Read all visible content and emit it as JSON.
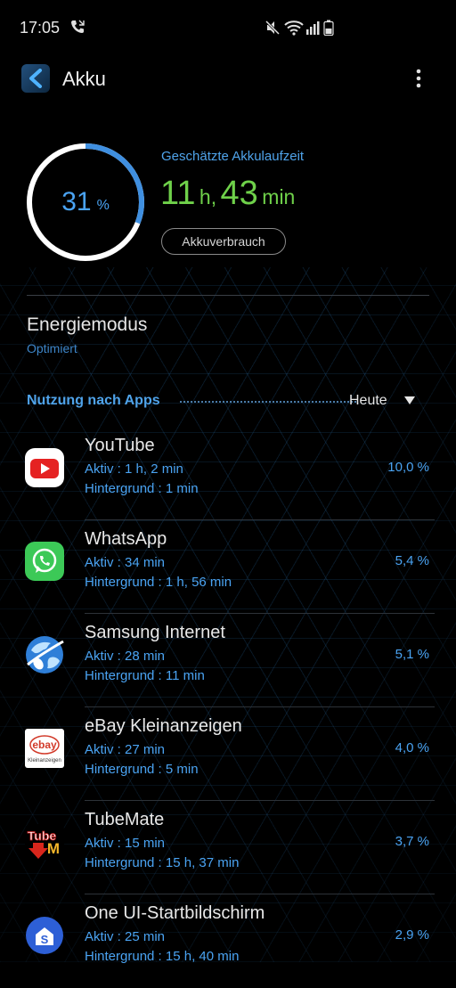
{
  "status_bar": {
    "time": "17:05",
    "icons": [
      "wifi-calling-icon",
      "mute-icon",
      "wifi-icon",
      "signal-icon",
      "battery-icon"
    ]
  },
  "app_bar": {
    "title": "Akku",
    "icons": [
      "back-icon",
      "more-options-icon"
    ]
  },
  "battery": {
    "percent_value": "31",
    "percent_sign": "%",
    "level_fraction": 0.31,
    "estimate_label": "Geschätzte Akkulaufzeit",
    "hours": "11",
    "hours_unit": "h,",
    "minutes": "43",
    "minutes_unit": "min",
    "usage_button": "Akkuverbrauch"
  },
  "power_mode": {
    "title": "Energiemodus",
    "value": "Optimiert"
  },
  "usage_section": {
    "label": "Nutzung nach Apps",
    "period": "Heute"
  },
  "apps": [
    {
      "name": "YouTube",
      "active": "Aktiv : 1 h, 2 min",
      "background": "Hintergrund : 1 min",
      "percent": "10,0 %",
      "icon": "youtube-icon"
    },
    {
      "name": "WhatsApp",
      "active": "Aktiv : 34 min",
      "background": "Hintergrund : 1 h, 56 min",
      "percent": "5,4 %",
      "icon": "whatsapp-icon"
    },
    {
      "name": "Samsung Internet",
      "active": "Aktiv : 28 min",
      "background": "Hintergrund : 11 min",
      "percent": "5,1 %",
      "icon": "samsung-internet-icon"
    },
    {
      "name": "eBay Kleinanzeigen",
      "active": "Aktiv : 27 min",
      "background": "Hintergrund : 5 min",
      "percent": "4,0 %",
      "icon": "ebay-kleinanzeigen-icon",
      "icon_text_top": "ebay",
      "icon_text_bottom": "Kleinanzeigen"
    },
    {
      "name": "TubeMate",
      "active": "Aktiv : 15 min",
      "background": "Hintergrund : 15 h, 37 min",
      "percent": "3,7 %",
      "icon": "tubemate-icon",
      "icon_text_top": "Tube",
      "icon_text_bottom": "M"
    },
    {
      "name": "One UI-Startbildschirm",
      "active": "Aktiv : 25 min",
      "background": "Hintergrund : 15 h, 40 min",
      "percent": "2,9 %",
      "icon": "one-ui-home-icon",
      "icon_text_top": "S"
    }
  ],
  "colors": {
    "accent_blue": "#4aa3f2",
    "time_green": "#6fd14a",
    "background": "#000000"
  }
}
